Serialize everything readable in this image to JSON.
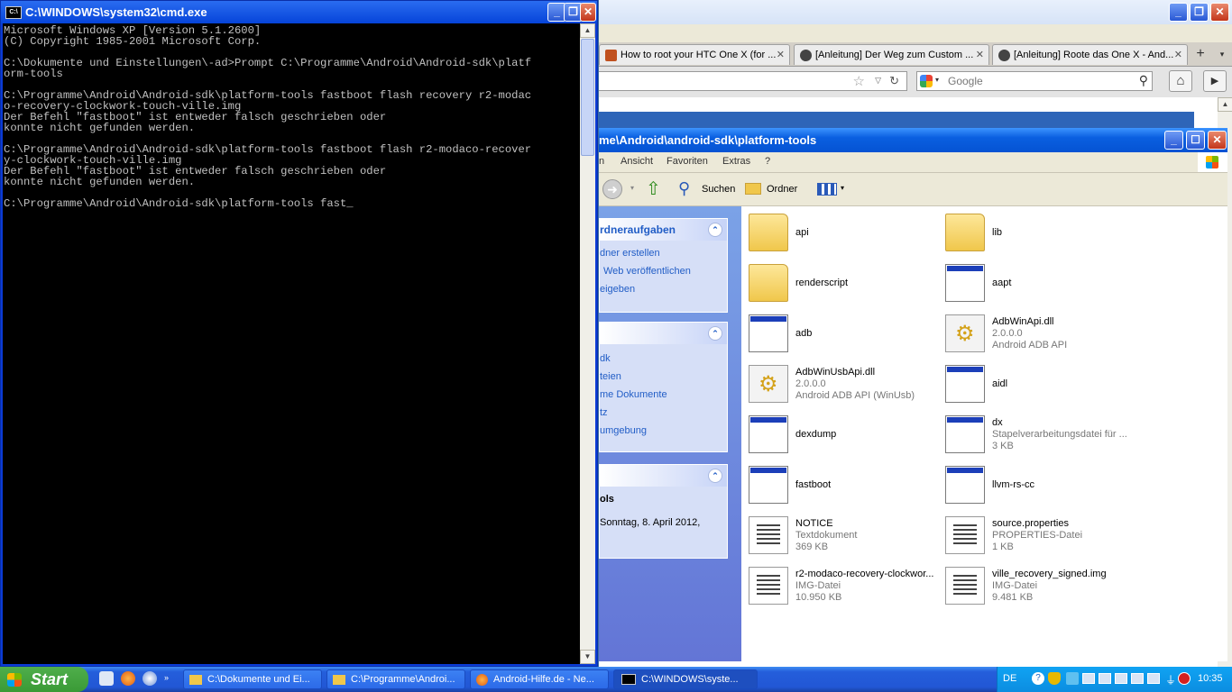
{
  "firefox": {
    "tabs": [
      {
        "label": "How to root your HTC One X (for ...",
        "favicon": "xda-icon"
      },
      {
        "label": "[Anleitung] Der Weg zum Custom ...",
        "favicon": "android-icon"
      },
      {
        "label": "[Anleitung] Roote das One X - And...",
        "favicon": "android-icon"
      }
    ],
    "search_placeholder": "Google"
  },
  "explorer": {
    "title": "me\\Android\\android-sdk\\platform-tools",
    "menu": [
      "n",
      "Ansicht",
      "Favoriten",
      "Extras",
      "?"
    ],
    "toolbar": {
      "search": "Suchen",
      "folders": "Ordner"
    },
    "tasks_panel": {
      "title": "rdneraufgaben",
      "items": [
        "dner erstellen",
        "Web veröffentlichen",
        "eigeben"
      ]
    },
    "places_panel": {
      "items": [
        "dk",
        "teien",
        "me Dokumente",
        "tz",
        "umgebung"
      ]
    },
    "details_panel": {
      "title": "ols",
      "date": "Sonntag, 8. April 2012,"
    },
    "files": [
      {
        "name": "api",
        "type": "folder",
        "line2": "",
        "line3": ""
      },
      {
        "name": "lib",
        "type": "folder",
        "line2": "",
        "line3": ""
      },
      {
        "name": "renderscript",
        "type": "folder",
        "line2": "",
        "line3": ""
      },
      {
        "name": "aapt",
        "type": "exe",
        "line2": "",
        "line3": ""
      },
      {
        "name": "adb",
        "type": "exe",
        "line2": "",
        "line3": ""
      },
      {
        "name": "AdbWinApi.dll",
        "type": "dll",
        "line2": "2.0.0.0",
        "line3": "Android ADB API"
      },
      {
        "name": "AdbWinUsbApi.dll",
        "type": "dll",
        "line2": "2.0.0.0",
        "line3": "Android ADB API (WinUsb)"
      },
      {
        "name": "aidl",
        "type": "exe",
        "line2": "",
        "line3": ""
      },
      {
        "name": "dexdump",
        "type": "exe",
        "line2": "",
        "line3": ""
      },
      {
        "name": "dx",
        "type": "bat",
        "line2": "Stapelverarbeitungsdatei für ...",
        "line3": "3 KB"
      },
      {
        "name": "fastboot",
        "type": "exe",
        "line2": "",
        "line3": ""
      },
      {
        "name": "llvm-rs-cc",
        "type": "exe",
        "line2": "",
        "line3": ""
      },
      {
        "name": "NOTICE",
        "type": "text",
        "line2": "Textdokument",
        "line3": "369 KB"
      },
      {
        "name": "source.properties",
        "type": "doc",
        "line2": "PROPERTIES-Datei",
        "line3": "1 KB"
      },
      {
        "name": "r2-modaco-recovery-clockwor...",
        "type": "doc",
        "line2": "IMG-Datei",
        "line3": "10.950 KB"
      },
      {
        "name": "ville_recovery_signed.img",
        "type": "doc",
        "line2": "IMG-Datei",
        "line3": "9.481 KB"
      }
    ]
  },
  "cmd": {
    "title": "C:\\WINDOWS\\system32\\cmd.exe",
    "output": "Microsoft Windows XP [Version 5.1.2600]\n(C) Copyright 1985-2001 Microsoft Corp.\n\nC:\\Dokumente und Einstellungen\\-ad>Prompt C:\\Programme\\Android\\Android-sdk\\platf\norm-tools\n\nC:\\Programme\\Android\\Android-sdk\\platform-tools fastboot flash recovery r2-modac\no-recovery-clockwork-touch-ville.img\nDer Befehl \"fastboot\" ist entweder falsch geschrieben oder\nkonnte nicht gefunden werden.\n\nC:\\Programme\\Android\\Android-sdk\\platform-tools fastboot flash r2-modaco-recover\ny-clockwork-touch-ville.img\nDer Befehl \"fastboot\" ist entweder falsch geschrieben oder\nkonnte nicht gefunden werden.\n\nC:\\Programme\\Android\\Android-sdk\\platform-tools fast_"
  },
  "taskbar": {
    "start_label": "Start",
    "items": [
      {
        "label": "C:\\Dokumente und Ei...",
        "icon": "folder-icon"
      },
      {
        "label": "C:\\Programme\\Androi...",
        "icon": "folder-icon"
      },
      {
        "label": "Android-Hilfe.de - Ne...",
        "icon": "firefox-icon"
      },
      {
        "label": "C:\\WINDOWS\\syste...",
        "icon": "cmd-icon"
      }
    ],
    "language": "DE",
    "clock": "10:35"
  }
}
